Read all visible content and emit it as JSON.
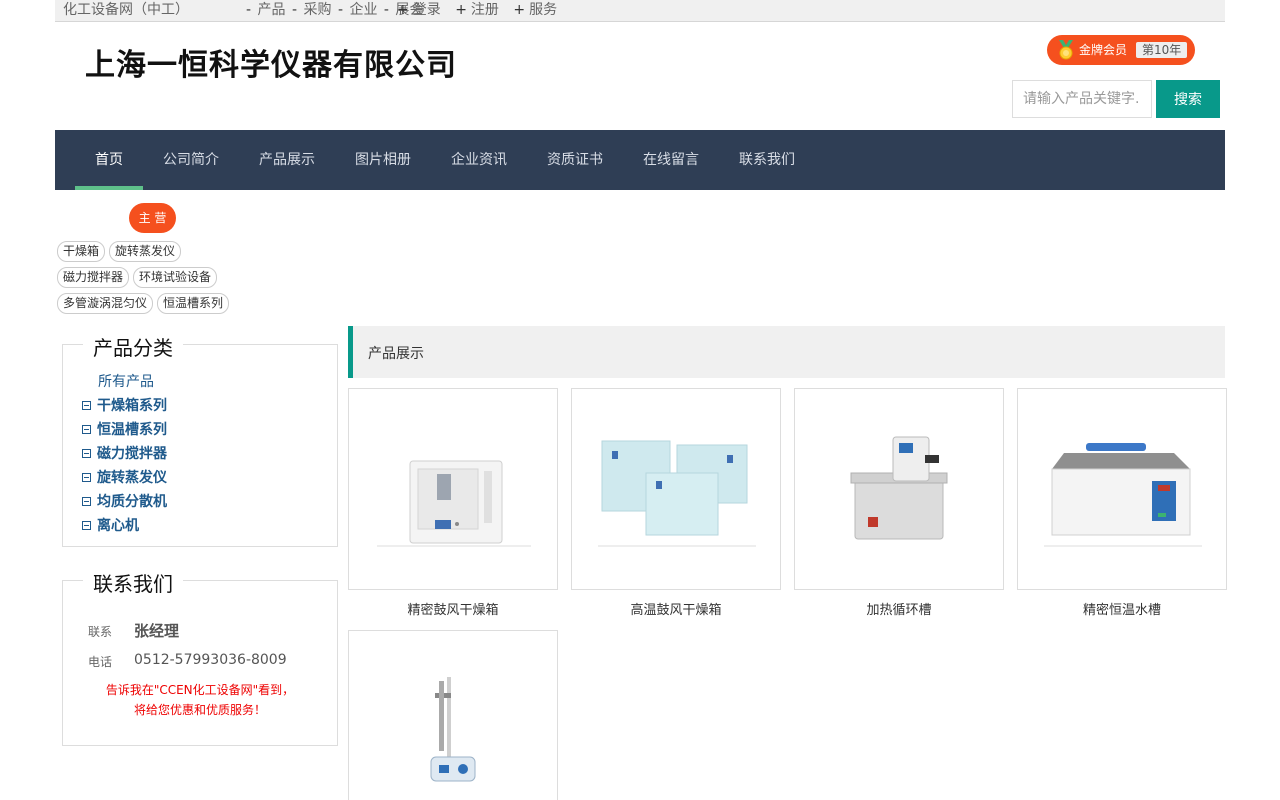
{
  "topbar": {
    "site": "化工设备网（中工）",
    "links": [
      "产品",
      "采购",
      "企业",
      "展会"
    ],
    "user_links": [
      "登录",
      "注册",
      "服务"
    ]
  },
  "header": {
    "company": "上海一恒科学仪器有限公司",
    "badge_label": "金牌会员",
    "badge_years": "第10年",
    "search_placeholder": "请输入产品关键字...",
    "search_button": "搜索"
  },
  "nav": [
    "首页",
    "公司简介",
    "产品展示",
    "图片相册",
    "企业资讯",
    "资质证书",
    "在线留言",
    "联系我们"
  ],
  "main": {
    "tag_title": "主 营",
    "tags": [
      "干燥箱",
      "旋转蒸发仪",
      "磁力搅拌器",
      "环境试验设备",
      "多管漩涡混匀仪",
      "恒温槽系列"
    ]
  },
  "sidebar": {
    "category_title": "产品分类",
    "all_products": "所有产品",
    "categories": [
      "干燥箱系列",
      "恒温槽系列",
      "磁力搅拌器",
      "旋转蒸发仪",
      "均质分散机",
      "离心机"
    ],
    "contact_title": "联系我们",
    "contact_label": "联系",
    "contact_name": "张经理",
    "phone_label": "电话",
    "phone": "0512-57993036-8009",
    "notice_line1": "告诉我在\"CCEN化工设备网\"看到，",
    "notice_line2": "将给您优惠和优质服务！"
  },
  "products": {
    "header": "产品展示",
    "items": [
      {
        "name": "精密鼓风干燥箱",
        "icon": "drying-oven-image"
      },
      {
        "name": "高温鼓风干燥箱",
        "icon": "high-temp-oven-image"
      },
      {
        "name": "加热循环槽",
        "icon": "circulating-bath-image"
      },
      {
        "name": "精密恒温水槽",
        "icon": "water-bath-image"
      },
      {
        "name": "",
        "icon": "magnetic-stirrer-image"
      }
    ]
  },
  "colors": {
    "nav_bg": "#2f3e55",
    "accent_teal": "#08998a",
    "accent_orange": "#f5501e",
    "link_blue": "#1f5a8c"
  }
}
